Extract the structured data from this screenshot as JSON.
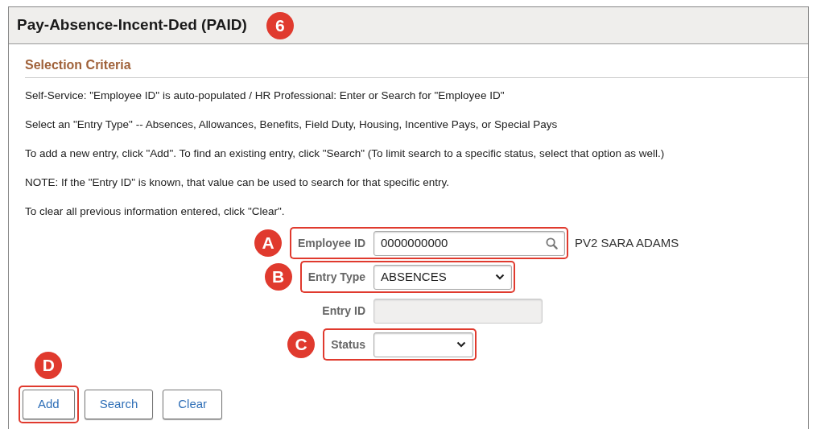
{
  "page": {
    "title": "Pay-Absence-Incent-Ded (PAID)",
    "callout": "6"
  },
  "section": {
    "heading": "Selection Criteria"
  },
  "instructions": [
    "Self-Service: \"Employee ID\" is auto-populated / HR Professional: Enter or Search for \"Employee ID\"",
    "Select an \"Entry Type\" -- Absences, Allowances, Benefits, Field Duty, Housing, Incentive Pays, or Special Pays",
    "To add a new entry, click \"Add\". To find an existing entry, click \"Search\" (To limit search to a specific status, select that option as well.)",
    "NOTE: If the \"Entry ID\" is known, that value can be used to search for that specific entry.",
    "To clear all previous information entered, click \"Clear\"."
  ],
  "fields": [
    {
      "kind": "search",
      "label": "Employee ID",
      "value": "0000000000",
      "note": "PV2 SARA ADAMS",
      "callout": "A",
      "highlighted": true
    },
    {
      "kind": "select",
      "label": "Entry Type",
      "value": "ABSENCES",
      "callout": "B",
      "highlighted": true
    },
    {
      "kind": "text",
      "label": "Entry ID",
      "highlighted": false,
      "disabled": true
    },
    {
      "kind": "select",
      "label": "Status",
      "callout": "C",
      "highlighted": true
    }
  ],
  "buttons": [
    {
      "label": "Add",
      "callout": "D",
      "highlighted": true
    },
    {
      "label": "Search",
      "highlighted": false
    },
    {
      "label": "Clear",
      "highlighted": false
    }
  ]
}
